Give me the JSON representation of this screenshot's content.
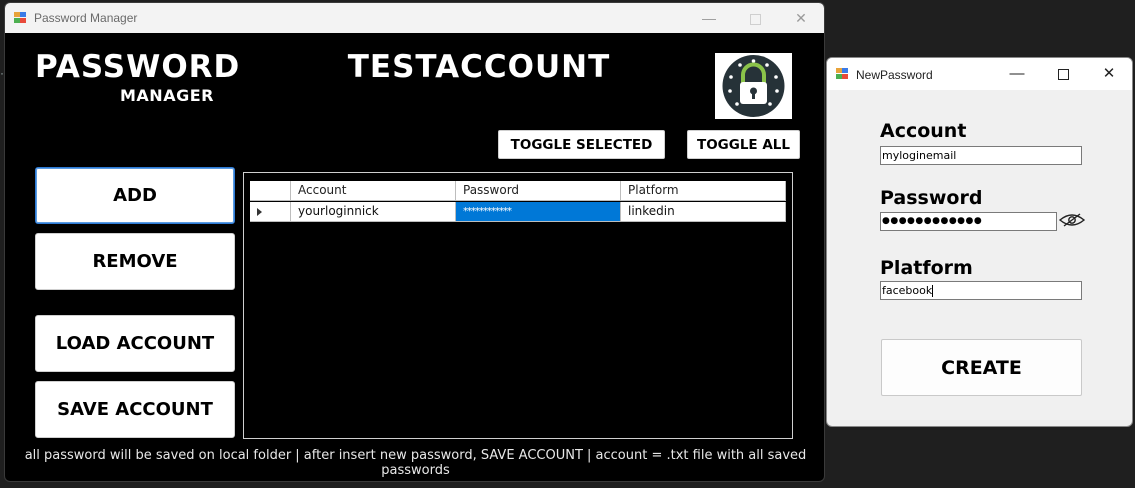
{
  "main_window": {
    "title": "Password Manager",
    "brand_title": "PASSWORD",
    "brand_subtitle": "MANAGER",
    "account_name": "TESTACCOUNT",
    "account_underline": "_ _ _ _ _ _ _ _ _ _ _ _ _ _ _ _ _ _ _ _ _ _ _",
    "toggle_selected_label": "TOGGLE SELECTED",
    "toggle_all_label": "TOGGLE ALL",
    "side_buttons": {
      "add": "ADD",
      "remove": "REMOVE",
      "load_account": "LOAD ACCOUNT",
      "save_account": "SAVE ACCOUNT"
    },
    "grid": {
      "headers": [
        "Account",
        "Password",
        "Platform"
      ],
      "rows": [
        {
          "account": "yourloginnick",
          "password": "************",
          "platform": "linkedin"
        }
      ]
    },
    "footer_note": "all password will be saved on local folder | after insert new password, SAVE ACCOUNT | account = .txt file with all saved passwords",
    "logo_icon": "lock-icon",
    "accent_color": "#0078d7"
  },
  "new_password_dialog": {
    "title": "NewPassword",
    "account_label": "Account",
    "account_value": "myloginemail",
    "password_label": "Password",
    "password_value": "●●●●●●●●●●●●",
    "platform_label": "Platform",
    "platform_value": "facebook",
    "create_label": "CREATE",
    "reveal_icon": "eye-slash-icon"
  },
  "window_controls": {
    "minimize": "—",
    "close": "✕"
  }
}
